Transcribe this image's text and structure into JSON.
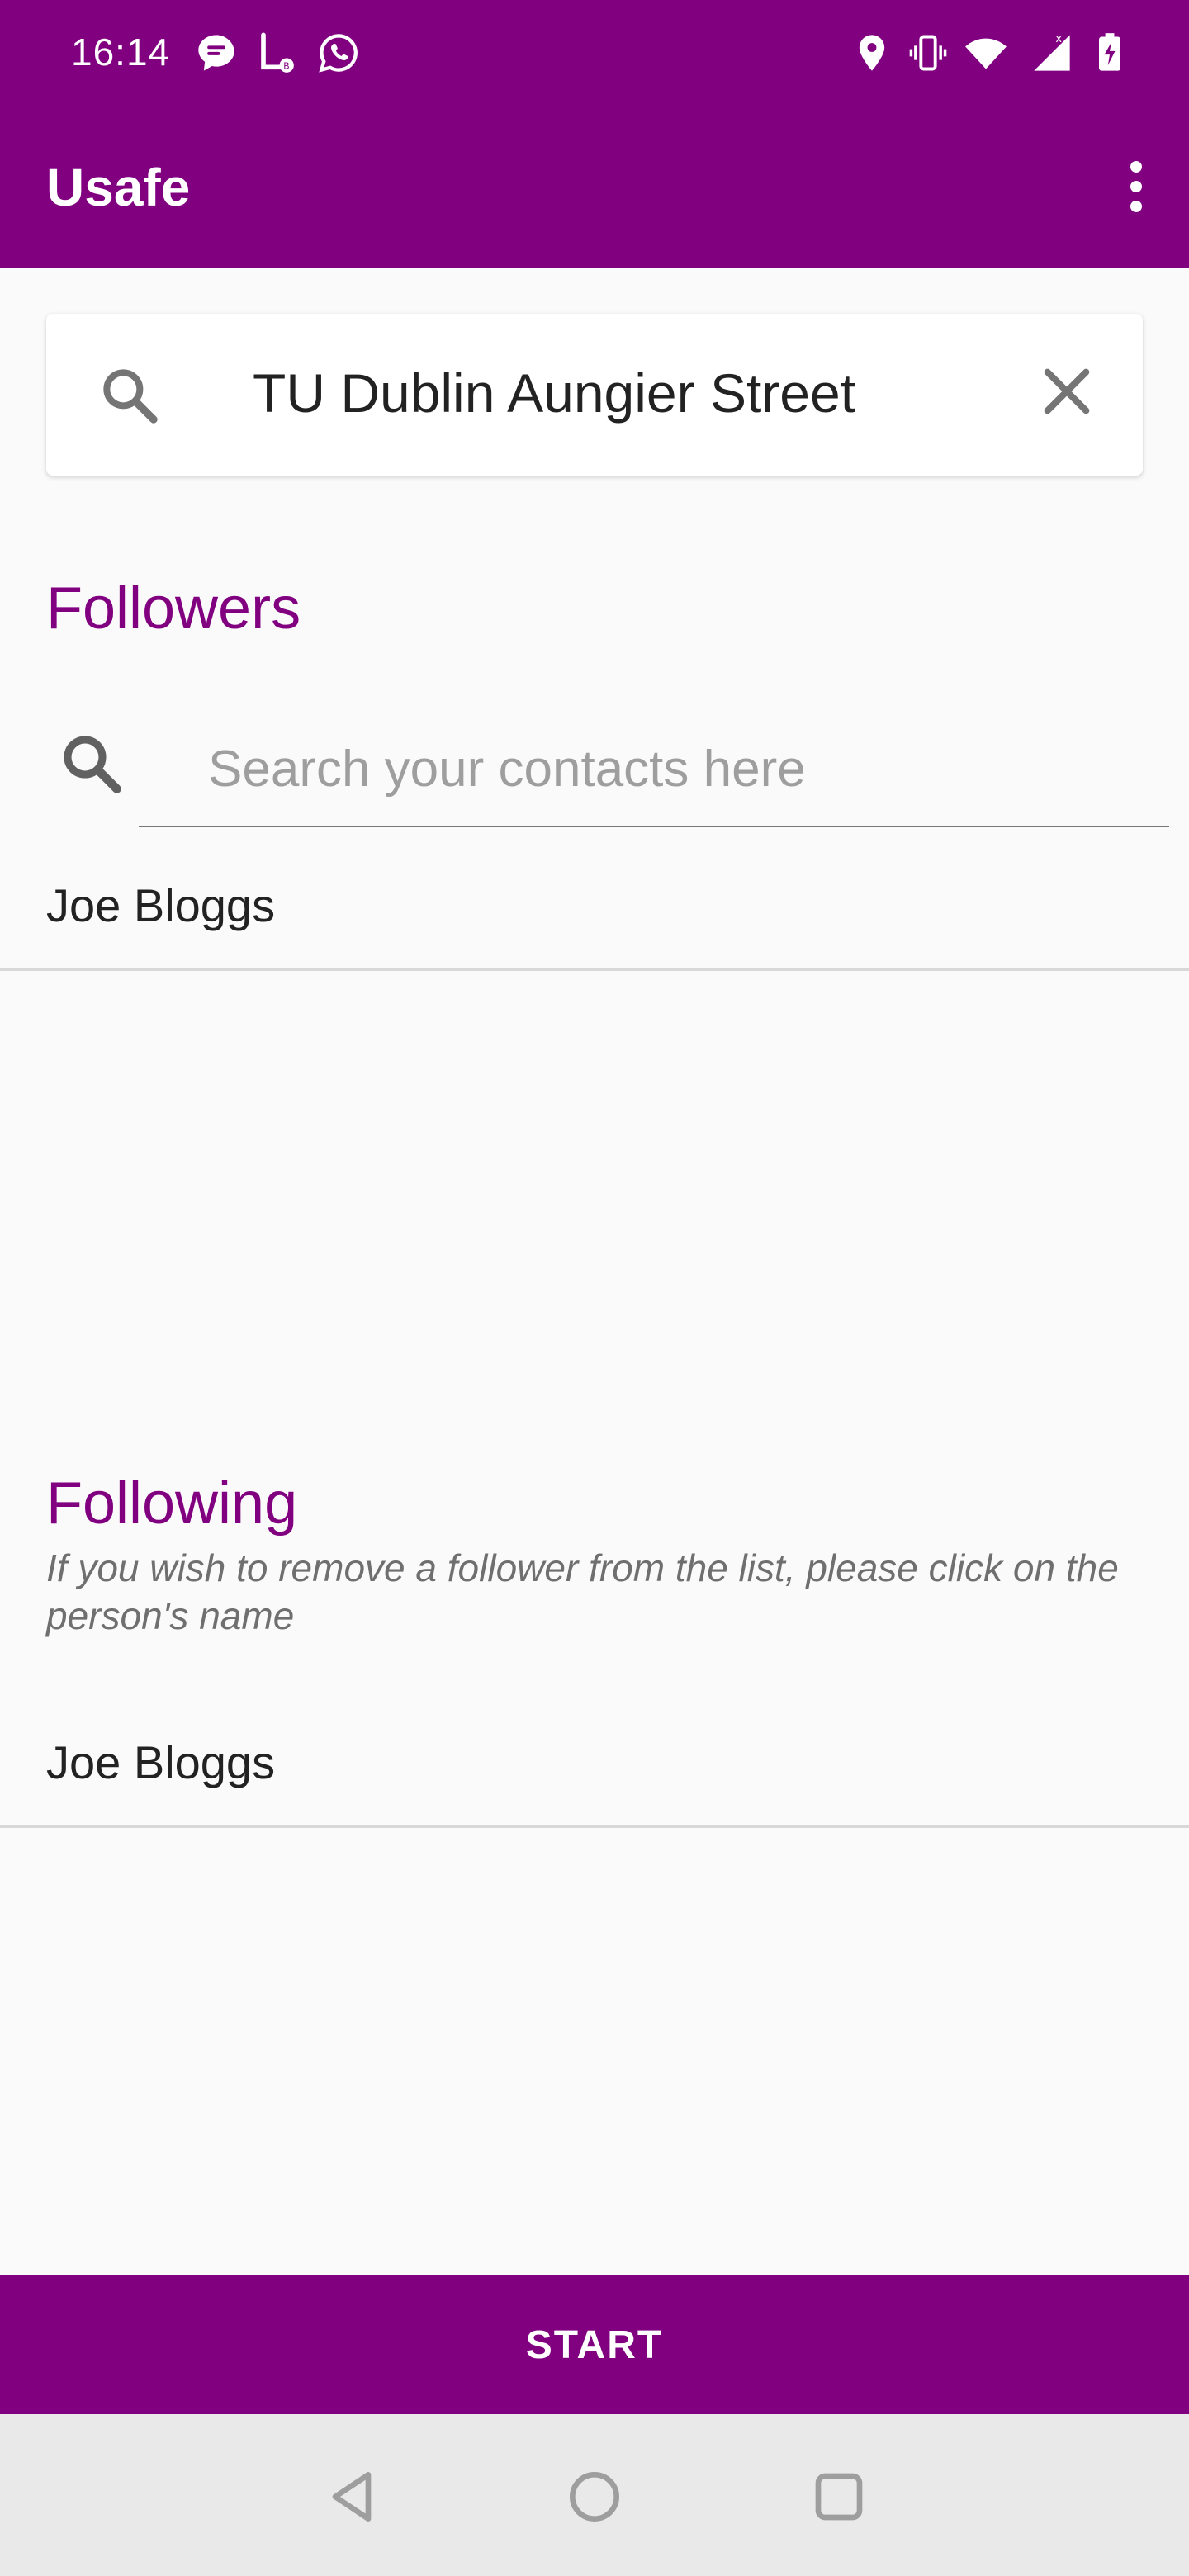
{
  "status_bar": {
    "time": "16:14",
    "left_icons": [
      "chat-bubble-icon",
      "tasker-icon",
      "whatsapp-icon"
    ],
    "right_icons": [
      "location-icon",
      "vibrate-icon",
      "wifi-icon",
      "signal-icon",
      "battery-charging-icon"
    ]
  },
  "app_bar": {
    "title": "Usafe",
    "menu_icon": "more-vert-icon"
  },
  "place_search": {
    "value": "TU Dublin Aungier Street",
    "search_icon": "search-icon",
    "clear_icon": "close-icon"
  },
  "followers": {
    "title": "Followers",
    "search_placeholder": "Search your contacts here",
    "items": [
      {
        "name": "Joe Bloggs"
      }
    ]
  },
  "following": {
    "title": "Following",
    "hint": "If you wish to remove a follower from the list, please click on the person's name",
    "items": [
      {
        "name": "Joe Bloggs"
      }
    ]
  },
  "start_button": {
    "label": "START"
  },
  "nav_bar": {
    "buttons": [
      "back-icon",
      "home-icon",
      "recents-icon"
    ]
  },
  "colors": {
    "primary": "#800080",
    "background": "#fafafa",
    "nav_bar": "#e9e9e9"
  }
}
